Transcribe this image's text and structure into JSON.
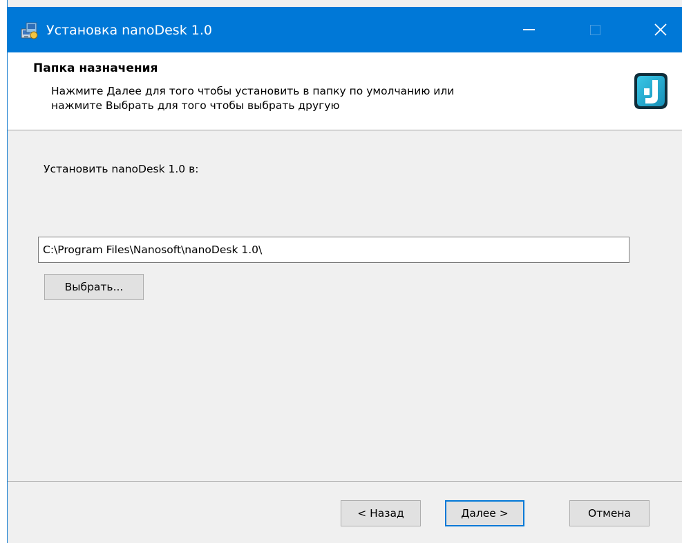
{
  "window": {
    "title": "Установка nanoDesk 1.0",
    "accent_color": "#0078d7",
    "icons": {
      "app": "installer-icon",
      "minimize": "minimize-icon",
      "maximize": "maximize-icon",
      "close": "close-icon",
      "brand": "nanosoft-logo-icon"
    }
  },
  "header": {
    "title": "Папка назначения",
    "description_line1": "Нажмите Далее для того чтобы установить в папку по умолчанию или",
    "description_line2": "нажмите Выбрать для того чтобы выбрать другую"
  },
  "body": {
    "install_label": "Установить nanoDesk 1.0 в:",
    "path_value": "C:\\Program Files\\Nanosoft\\nanoDesk 1.0\\",
    "browse_label": "Выбрать..."
  },
  "footer": {
    "back_label": "< Назад",
    "next_label": "Далее >",
    "cancel_label": "Отмена"
  }
}
